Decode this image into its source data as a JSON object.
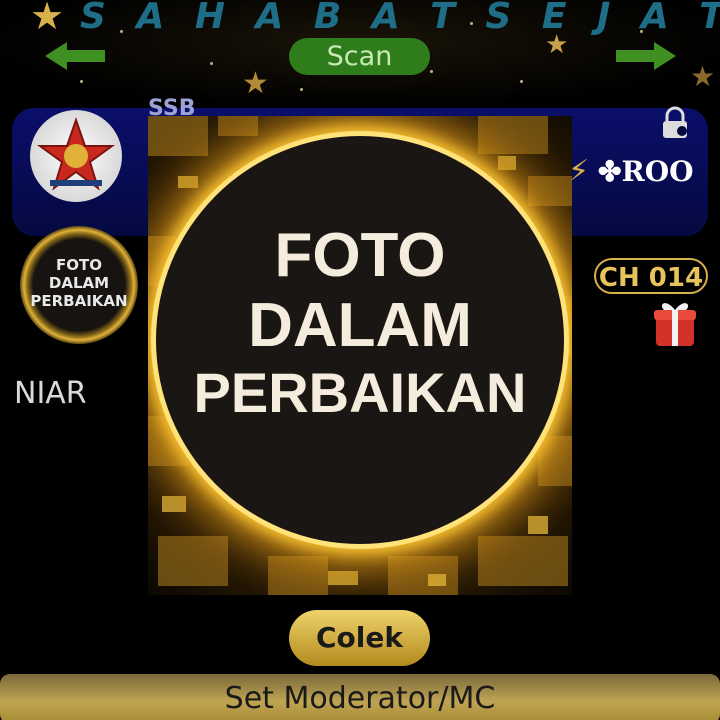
{
  "banner": {
    "marquee_text": "S A H A B A T  S E J A T I  B E R",
    "scan_label": "Scan",
    "left_arrow_icon": "arrow-left-icon",
    "right_arrow_icon": "arrow-right-icon"
  },
  "room_card": {
    "obscured_title": "SSB",
    "badge_text": "ROO",
    "lock_icon": "lock-icon"
  },
  "host": {
    "avatar_text": "FOTO DALAM PERBAIKAN",
    "name": "NIAR",
    "channel_badge": "CH 014"
  },
  "overlay": {
    "line1": "FOTO",
    "line2": "DALAM",
    "line3": "PERBAIKAN"
  },
  "actions": {
    "colek_label": "Colek",
    "set_moderator_label": "Set Moderator/MC"
  },
  "colors": {
    "scan_green": "#2e7d1a",
    "gold": "#d9b04a",
    "card_blue": "#0a0f6a",
    "marquee_teal": "#1f6e88"
  }
}
